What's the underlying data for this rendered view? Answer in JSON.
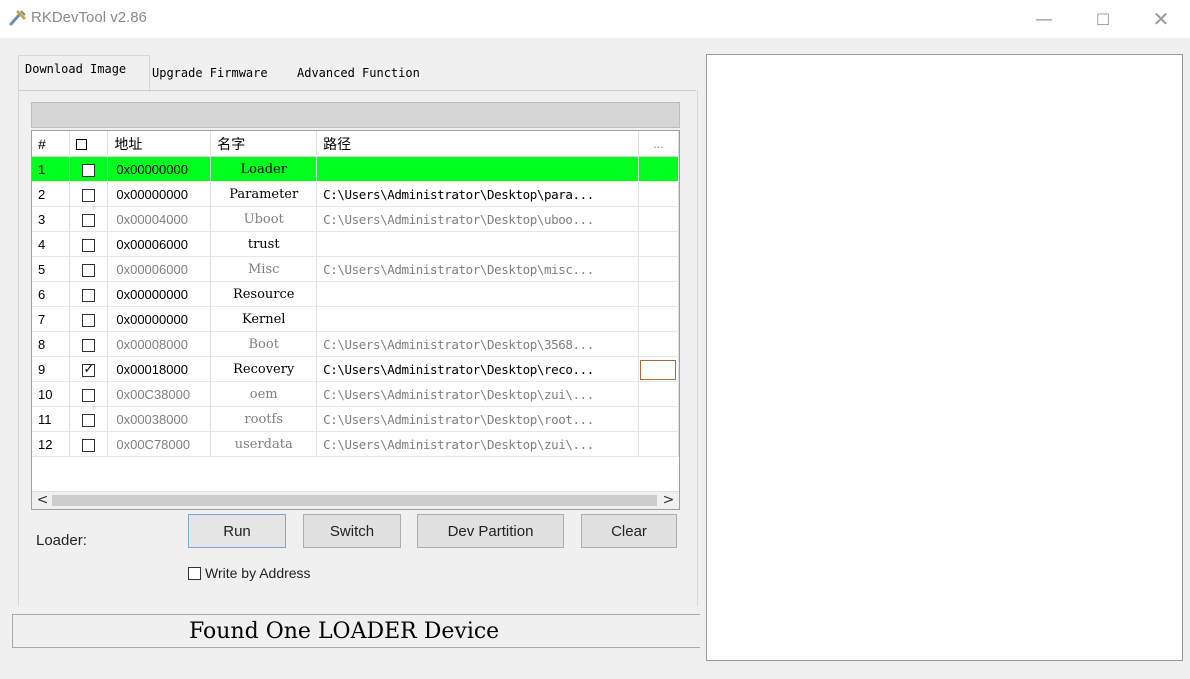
{
  "window": {
    "title": "RKDevTool v2.86",
    "minimize_glyph": "—",
    "maximize_glyph": "☐",
    "close_glyph": "✕"
  },
  "tabs": [
    {
      "label": "Download Image",
      "selected": true
    },
    {
      "label": "Upgrade Firmware",
      "selected": false
    },
    {
      "label": "Advanced Function",
      "selected": false
    }
  ],
  "table": {
    "headers": {
      "num": "#",
      "check": "☐",
      "address": "地址",
      "name": "名字",
      "path": "路径",
      "more": "..."
    },
    "rows": [
      {
        "num": "1",
        "checked": false,
        "address": "0x00000000",
        "name": "Loader",
        "path": "",
        "style": "loader"
      },
      {
        "num": "2",
        "checked": false,
        "address": "0x00000000",
        "name": "Parameter",
        "path": "C:\\Users\\Administrator\\Desktop\\para...",
        "style": "dark"
      },
      {
        "num": "3",
        "checked": false,
        "address": "0x00004000",
        "name": "Uboot",
        "path": "C:\\Users\\Administrator\\Desktop\\uboo...",
        "style": "grey"
      },
      {
        "num": "4",
        "checked": false,
        "address": "0x00006000",
        "name": "trust",
        "path": "",
        "style": "dark"
      },
      {
        "num": "5",
        "checked": false,
        "address": "0x00006000",
        "name": "Misc",
        "path": "C:\\Users\\Administrator\\Desktop\\misc...",
        "style": "grey"
      },
      {
        "num": "6",
        "checked": false,
        "address": "0x00000000",
        "name": "Resource",
        "path": "",
        "style": "dark"
      },
      {
        "num": "7",
        "checked": false,
        "address": "0x00000000",
        "name": "Kernel",
        "path": "",
        "style": "dark"
      },
      {
        "num": "8",
        "checked": false,
        "address": "0x00008000",
        "name": "Boot",
        "path": "C:\\Users\\Administrator\\Desktop\\3568...",
        "style": "grey"
      },
      {
        "num": "9",
        "checked": true,
        "address": "0x00018000",
        "name": "Recovery",
        "path": "C:\\Users\\Administrator\\Desktop\\reco...",
        "style": "dark",
        "more_active": true
      },
      {
        "num": "10",
        "checked": false,
        "address": "0x00C38000",
        "name": "oem",
        "path": "C:\\Users\\Administrator\\Desktop\\zui\\...",
        "style": "grey"
      },
      {
        "num": "11",
        "checked": false,
        "address": "0x00038000",
        "name": "rootfs",
        "path": "C:\\Users\\Administrator\\Desktop\\root...",
        "style": "grey"
      },
      {
        "num": "12",
        "checked": false,
        "address": "0x00C78000",
        "name": "userdata",
        "path": "C:\\Users\\Administrator\\Desktop\\zui\\...",
        "style": "grey"
      }
    ]
  },
  "scroll": {
    "left_glyph": "<",
    "right_glyph": ">"
  },
  "controls": {
    "loader_label": "Loader:",
    "run": "Run",
    "switch": "Switch",
    "dev_partition": "Dev Partition",
    "clear": "Clear",
    "write_by_address": "Write by Address"
  },
  "status": {
    "text": "Found One LOADER Device"
  },
  "colors": {
    "loader_row": "#00ff1e",
    "active_cell_border": "#b06a3a"
  }
}
